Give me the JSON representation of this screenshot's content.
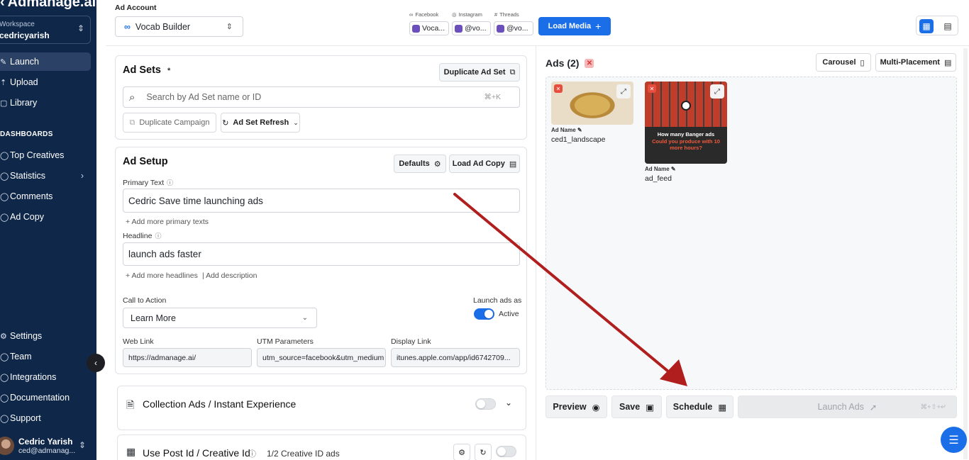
{
  "brand": {
    "name": "Admanage.ai",
    "back_glyph": "‹"
  },
  "workspace": {
    "label": "Workspace",
    "value": "cedricyarish"
  },
  "nav": {
    "items": [
      {
        "label": "Launch",
        "icon": "rocket-icon",
        "active": true
      },
      {
        "label": "Upload",
        "icon": "upload-icon"
      },
      {
        "label": "Library",
        "icon": "library-icon"
      }
    ],
    "section": "DASHBOARDS",
    "dash_items": [
      {
        "label": "Top Creatives",
        "icon": "trophy-icon"
      },
      {
        "label": "Statistics",
        "icon": "chart-icon",
        "arrow": "›"
      },
      {
        "label": "Comments",
        "icon": "comment-icon"
      },
      {
        "label": "Ad Copy",
        "icon": "copy-icon"
      }
    ],
    "bottom_items": [
      {
        "label": "Settings",
        "icon": "gear-icon"
      },
      {
        "label": "Team",
        "icon": "team-icon"
      },
      {
        "label": "Integrations",
        "icon": "plug-icon"
      },
      {
        "label": "Documentation",
        "icon": "doc-icon"
      },
      {
        "label": "Support",
        "icon": "support-icon"
      }
    ]
  },
  "user": {
    "name": "Cedric Yarish",
    "email": "ced@admanag..."
  },
  "top": {
    "ad_account_label": "Ad Account",
    "ad_account_value": "Vocab Builder",
    "platforms": {
      "facebook": "Facebook",
      "instagram": "Instagram",
      "threads": "Threads"
    },
    "chips": {
      "facebook": "Voca...",
      "instagram": "@vo...",
      "threads": "@vo..."
    },
    "load_media": "Load Media"
  },
  "ad_sets": {
    "title": "Ad Sets",
    "required": "*",
    "duplicate": "Duplicate Ad Set",
    "search_placeholder": "Search by Ad Set name or ID",
    "shortcut": "⌘+K",
    "dup_campaign": "Duplicate Campaign",
    "refresh": "Ad Set Refresh"
  },
  "ad_setup": {
    "title": "Ad Setup",
    "defaults": "Defaults",
    "load_copy": "Load Ad Copy",
    "primary_label": "Primary Text",
    "primary_value": "Cedric Save time launching ads",
    "add_primary": "+ Add more primary texts",
    "headline_label": "Headline",
    "headline_value": "launch ads faster",
    "add_headlines": "+ Add more headlines",
    "add_description": "| Add description",
    "cta_label": "Call to Action",
    "cta_value": "Learn More",
    "launch_as_label": "Launch ads as",
    "launch_as_value": "Active",
    "web_link_label": "Web Link",
    "web_link_value": "https://admanage.ai/",
    "utm_label": "UTM Parameters",
    "utm_value": "utm_source=facebook&utm_medium",
    "display_label": "Display Link",
    "display_value": "itunes.apple.com/app/id6742709..."
  },
  "collection": {
    "title": "Collection Ads / Instant Experience"
  },
  "post_id": {
    "title": "Use Post Id / Creative Id",
    "count": "1/2 Creative ID ads"
  },
  "ads": {
    "title": "Ads (2)",
    "carousel": "Carousel",
    "multi": "Multi-Placement",
    "cards": [
      {
        "name_label": "Ad Name",
        "name": "ced1_landscape"
      },
      {
        "name_label": "Ad Name",
        "name": "ad_feed",
        "headline": "How many Banger ads",
        "sub": "Could you produce with 10 more hours?"
      }
    ]
  },
  "actions": {
    "preview": "Preview",
    "save": "Save",
    "schedule": "Schedule",
    "launch": "Launch Ads",
    "launch_shortcut": "⌘+⇧+↵"
  },
  "colors": {
    "sidebar": "#0f2749",
    "primary": "#1a6ee8",
    "annotation_arrow": "#b01e1e"
  }
}
